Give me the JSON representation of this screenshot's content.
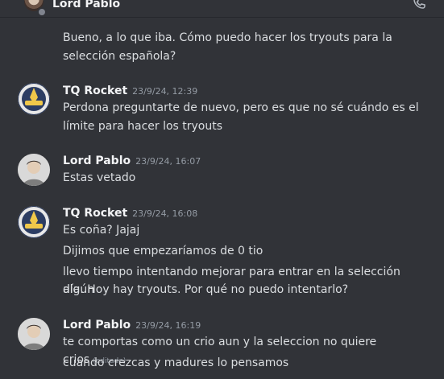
{
  "header": {
    "title": "Lord Pablo"
  },
  "messages": [
    {
      "author": "",
      "timestamp": "",
      "lines": [
        "Bueno, a lo que iba. Cómo puedo hacer los tryouts para la",
        "selección española?"
      ]
    },
    {
      "author": "TQ Rocket",
      "timestamp": "23/9/24, 12:39",
      "lines": [
        "Perdona preguntarte de nuevo, pero es que no sé cuándo es el",
        "límite para hacer los tryouts"
      ]
    },
    {
      "author": "Lord Pablo",
      "timestamp": "23/9/24, 16:07",
      "lines": [
        "Estas vetado"
      ]
    },
    {
      "author": "TQ Rocket",
      "timestamp": "23/9/24, 16:08",
      "lines": [
        "Es coña? Jajaj",
        "Dijimos que empezaríamos de 0 tio",
        "llevo tiempo intentando mejorar para entrar en la selección algún",
        "día. Hoy hay tryouts. Por qué no puedo intentarlo?"
      ]
    },
    {
      "author": "Lord Pablo",
      "timestamp": "23/9/24, 16:19",
      "lines": [
        "te comportas como un crio aun y la seleccion no quiere crios",
        "cuando crezcas y madures lo pensamos"
      ],
      "edited": "(editado)"
    }
  ]
}
